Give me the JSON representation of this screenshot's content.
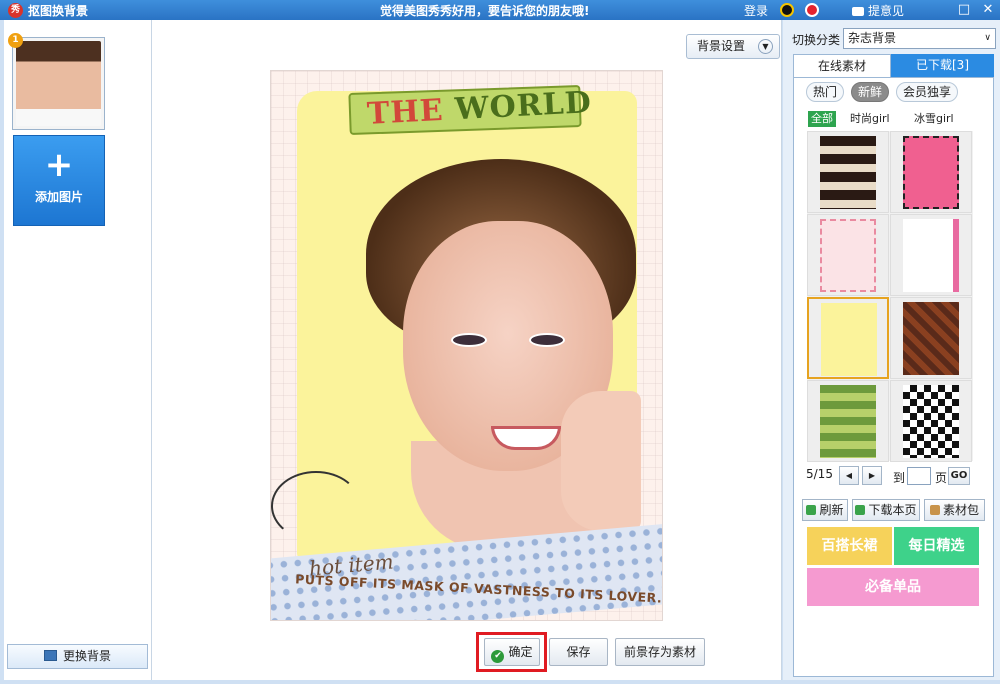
{
  "window": {
    "app_logo": "秀",
    "title": "抠图换背景",
    "slogan": "觉得美图秀秀好用，要告诉您的朋友哦!",
    "login": "登录",
    "feedback": "提意见",
    "maximize_glyph": "□",
    "close_glyph": "✕"
  },
  "left": {
    "thumb_badge": "1",
    "add_plus": "+",
    "add_label": "添加图片",
    "change_bg_label": "更换背景"
  },
  "canvas": {
    "bg_settings_label": "背景设置",
    "bg_settings_chevron": "▼",
    "poster": {
      "banner_word1": "THE",
      "banner_word2": "WORLD",
      "hot_item": "hot item",
      "caption": "PUTS OFF ITS MASK OF VASTNESS TO ITS LOVER."
    },
    "buttons": {
      "ok_check": "✔",
      "ok": "确定",
      "save": "保存",
      "save_foreground": "前景存为素材"
    }
  },
  "right": {
    "category_label": "切换分类",
    "category_value": "杂志背景",
    "category_arrow": "∨",
    "tab_online": "在线素材",
    "tab_downloaded": "已下载[3]",
    "filters": [
      "热门",
      "新鲜",
      "会员独享"
    ],
    "active_filter": "新鲜",
    "subfilters": [
      "全部",
      "时尚girl",
      "冰雪girl"
    ],
    "active_subfilter": "全部",
    "selected_tile_index": 4,
    "pager": {
      "current": "5/15",
      "prev_glyph": "◀",
      "next_glyph": "▶",
      "to_label": "到",
      "page_label": "页",
      "go_label": "GO"
    },
    "actions": {
      "refresh": "刷新",
      "download_page": "下载本页",
      "material_pack": "素材包"
    },
    "promos": {
      "promo1": "百搭长裙",
      "promo2": "每日精选",
      "promo3": "必备单品"
    }
  },
  "colors": {
    "titlebar": "#2a73c4",
    "accent_blue": "#2b8be2",
    "highlight_red": "#e01b22",
    "selected_orange": "#e6a320",
    "promo_yellow": "#f6d25a",
    "promo_green": "#3ed28a",
    "promo_pink": "#f59ad0"
  }
}
